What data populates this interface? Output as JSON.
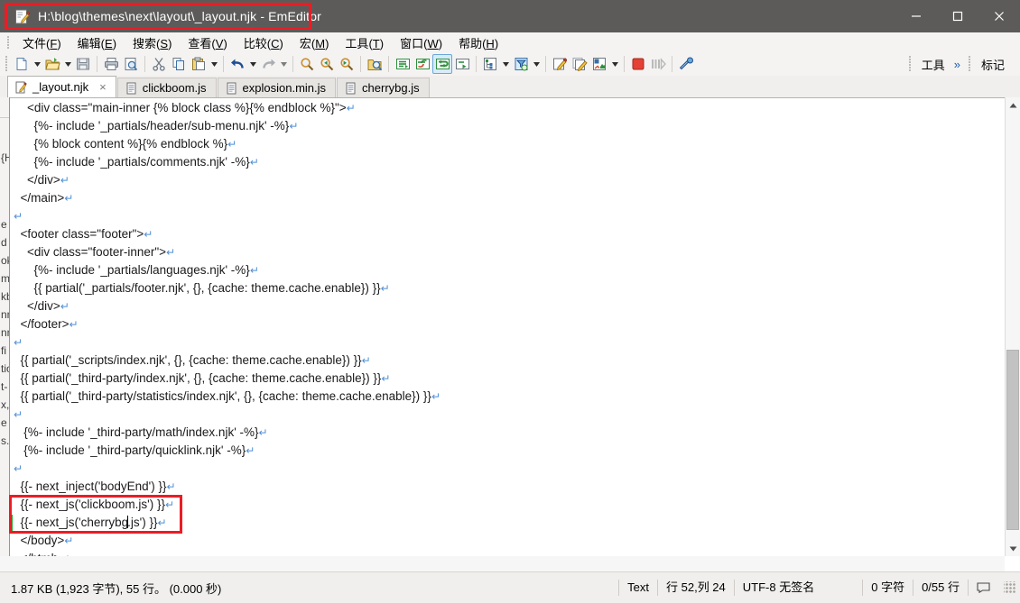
{
  "window": {
    "title": "H:\\blog\\themes\\next\\layout\\_layout.njk - EmEditor",
    "icon": "emeditor-document-icon",
    "minimize_label": "minimize-icon",
    "maximize_label": "maximize-icon",
    "close_label": "close-icon",
    "highlight_color": "#ec1c24",
    "titlebar_color": "#5d5b59"
  },
  "menu": {
    "items": [
      {
        "text": "文件",
        "accel": "F"
      },
      {
        "text": "编辑",
        "accel": "E"
      },
      {
        "text": "搜索",
        "accel": "S"
      },
      {
        "text": "查看",
        "accel": "V"
      },
      {
        "text": "比较",
        "accel": "C"
      },
      {
        "text": "宏",
        "accel": "M"
      },
      {
        "text": "工具",
        "accel": "T"
      },
      {
        "text": "窗口",
        "accel": "W"
      },
      {
        "text": "帮助",
        "accel": "H"
      }
    ]
  },
  "toolbar": {
    "buttons": [
      "new-file-icon",
      "new-file-dropdown",
      "open-file-icon",
      "open-file-dropdown",
      "save-icon",
      "print-icon",
      "print-preview-icon",
      "cut-icon",
      "copy-icon",
      "paste-icon",
      "paste-dropdown",
      "undo-icon",
      "undo-dropdown",
      "redo-icon",
      "redo-dropdown",
      "find-icon",
      "find-previous-icon",
      "find-next-icon",
      "find-in-files-icon",
      "replace-icon",
      "replace-in-files-icon",
      "replace-all-icon",
      "replace-next-icon",
      "outline-icon",
      "outline-dropdown",
      "filter-icon",
      "filter-dropdown",
      "macro-record-icon",
      "macro-play-icon",
      "macro-select-icon",
      "macro-dropdown",
      "stop-icon",
      "step-icon",
      "customize-icon"
    ],
    "overflow_label": "工具",
    "overflow_chevron": "»",
    "mark_label": "标记"
  },
  "tabs": [
    {
      "label": "_layout.njk",
      "active": true,
      "icon": "njk-file-icon",
      "close": "×"
    },
    {
      "label": "clickboom.js",
      "active": false,
      "icon": "js-file-icon"
    },
    {
      "label": "explosion.min.js",
      "active": false,
      "icon": "js-file-icon"
    },
    {
      "label": "cherrybg.js",
      "active": false,
      "icon": "js-file-icon"
    }
  ],
  "side_panel": {
    "clipped_lines": [
      "{H",
      "e",
      "d",
      "ok",
      "m",
      "kb",
      "nn",
      "nn",
      "fi",
      "tio",
      "t-",
      "x,j",
      "e",
      "s.j"
    ]
  },
  "editor": {
    "eol_glyph": "↵",
    "lines": [
      {
        "text": "    <div class=\"main-inner {% block class %}{% endblock %}\">",
        "eol": true
      },
      {
        "text": "      {%- include '_partials/header/sub-menu.njk' -%}",
        "eol": true
      },
      {
        "text": "      {% block content %}{% endblock %}",
        "eol": true
      },
      {
        "text": "      {%- include '_partials/comments.njk' -%}",
        "eol": true
      },
      {
        "text": "    </div>",
        "eol": true
      },
      {
        "text": "  </main>",
        "eol": true
      },
      {
        "text": "",
        "eol": true
      },
      {
        "text": "  <footer class=\"footer\">",
        "eol": true
      },
      {
        "text": "    <div class=\"footer-inner\">",
        "eol": true
      },
      {
        "text": "      {%- include '_partials/languages.njk' -%}",
        "eol": true
      },
      {
        "text": "      {{ partial('_partials/footer.njk', {}, {cache: theme.cache.enable}) }}",
        "eol": true
      },
      {
        "text": "    </div>",
        "eol": true
      },
      {
        "text": "  </footer>",
        "eol": true
      },
      {
        "text": "",
        "eol": true
      },
      {
        "text": "  {{ partial('_scripts/index.njk', {}, {cache: theme.cache.enable}) }}",
        "eol": true
      },
      {
        "text": "  {{ partial('_third-party/index.njk', {}, {cache: theme.cache.enable}) }}",
        "eol": true
      },
      {
        "text": "  {{ partial('_third-party/statistics/index.njk', {}, {cache: theme.cache.enable}) }}",
        "eol": true
      },
      {
        "text": "",
        "eol": true
      },
      {
        "text": "   {%- include '_third-party/math/index.njk' -%}",
        "eol": true
      },
      {
        "text": "   {%- include '_third-party/quicklink.njk' -%}",
        "eol": true
      },
      {
        "text": "",
        "eol": true
      },
      {
        "text": "  {{- next_inject('bodyEnd') }}",
        "eol": true
      },
      {
        "text": "  {{- next_js('clickboom.js') }}",
        "eol": true
      },
      {
        "text": "  {{- next_js('cherrybg.js') }}",
        "eol": true,
        "modified": true,
        "caret_after": "  {{- next_js('cherrybg"
      },
      {
        "text": "  </body>",
        "eol": true
      },
      {
        "text": "  </html>",
        "eol": true
      }
    ],
    "annotation_color": "#ec1c24",
    "modified_bar_color": "#22a832"
  },
  "status": {
    "file_info": "1.87 KB (1,923 字节), 55 行。 (0.000 秒)",
    "cells": [
      "Text",
      "行 52,列 24",
      "UTF-8 无签名"
    ],
    "right_cells": [
      "0 字符",
      "0/55 行"
    ],
    "comment_icon": "speech-bubble-icon"
  }
}
